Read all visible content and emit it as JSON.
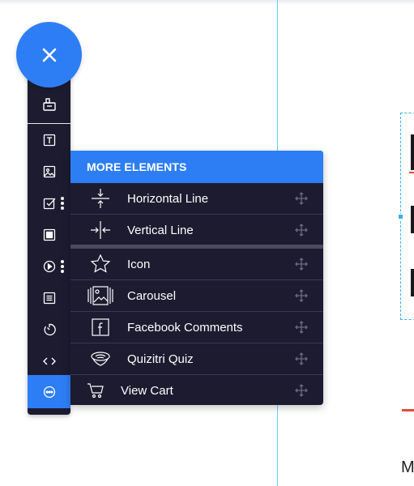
{
  "fab": {
    "icon": "close-icon"
  },
  "toolbar": {
    "tools": [
      {
        "icon": "widget-icon"
      },
      {
        "icon": "text-icon"
      },
      {
        "icon": "image-icon"
      },
      {
        "icon": "checkbox-icon",
        "has_more": true
      },
      {
        "icon": "box-icon"
      },
      {
        "icon": "play-icon",
        "has_more": true
      },
      {
        "icon": "form-icon"
      },
      {
        "icon": "timer-icon"
      },
      {
        "icon": "code-icon"
      },
      {
        "icon": "more-icon",
        "active": true
      }
    ]
  },
  "panel": {
    "title": "MORE ELEMENTS",
    "items": [
      {
        "label": "Horizontal Line",
        "icon": "horizontal-line-icon"
      },
      {
        "label": "Vertical Line",
        "icon": "vertical-line-icon"
      },
      {
        "label": "Icon",
        "icon": "star-icon"
      },
      {
        "label": "Carousel",
        "icon": "carousel-icon"
      },
      {
        "label": "Facebook Comments",
        "icon": "facebook-icon"
      },
      {
        "label": "Quizitri Quiz",
        "icon": "quiz-icon"
      },
      {
        "label": "View Cart",
        "icon": "cart-icon"
      }
    ]
  },
  "canvas": {
    "text_fragment": "M"
  },
  "colors": {
    "accent": "#2d7ef5",
    "toolbar_bg": "#1c1b30",
    "guide": "#5ed6f0",
    "danger": "#e8493b"
  }
}
